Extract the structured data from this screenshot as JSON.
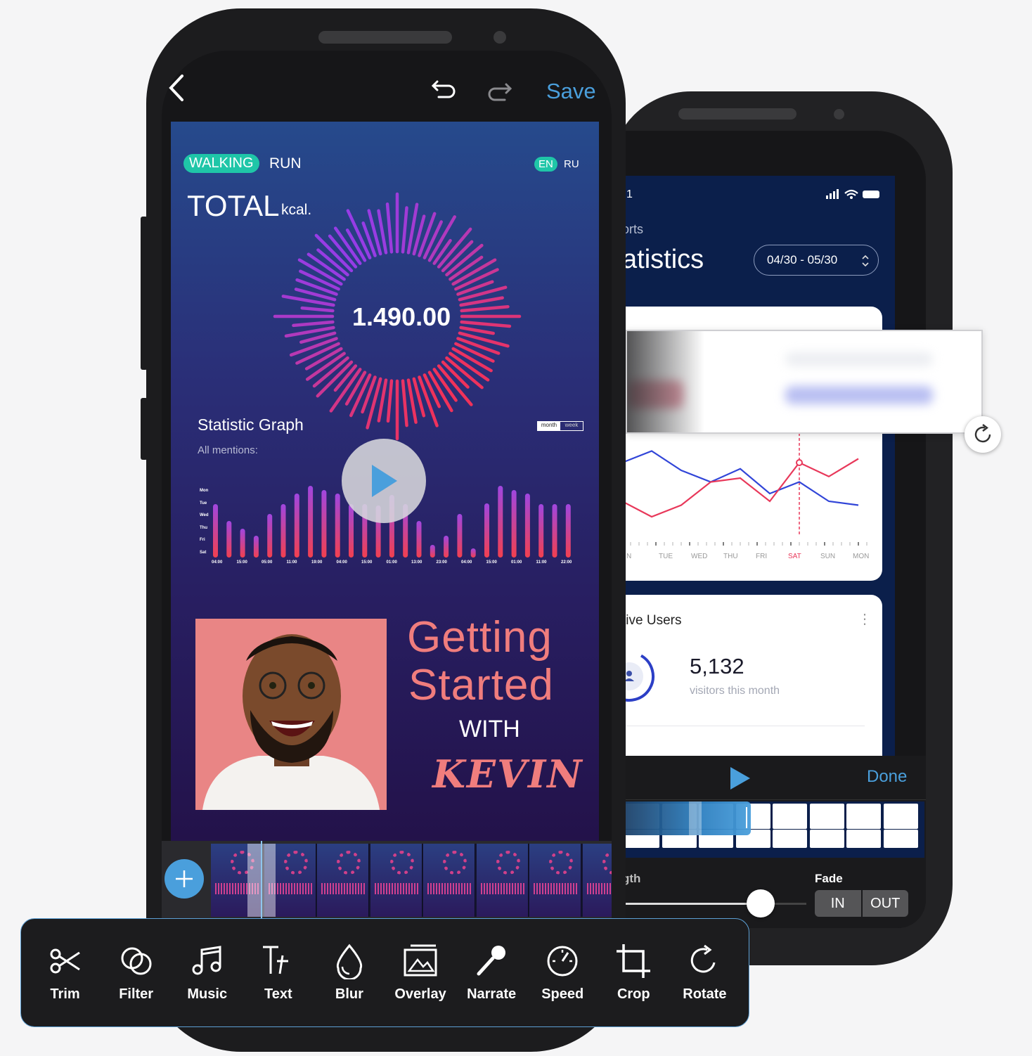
{
  "back_phone": {
    "status_time": "1",
    "breadcrumb": "orts",
    "title": "atistics",
    "date_range": "04/30 - 05/30",
    "chart_days": [
      "N",
      "TUE",
      "WED",
      "THU",
      "FRI",
      "SAT",
      "SUN",
      "MON"
    ],
    "highlight_day": "SAT",
    "series_red": [
      30,
      10,
      25,
      55,
      60,
      30,
      80,
      62,
      85
    ],
    "series_blue": [
      80,
      95,
      70,
      55,
      72,
      40,
      55,
      30,
      25
    ],
    "users_card": {
      "title": "tive Users",
      "value": "5,132",
      "caption": "visitors this month"
    },
    "editor": {
      "done_label": "Done",
      "length_label": "gth",
      "fade_label": "Fade",
      "fade_in": "IN",
      "fade_out": "OUT",
      "slider_value": 0.75
    }
  },
  "front_phone": {
    "save_label": "Save",
    "video": {
      "tab_walking": "WALKING",
      "tab_run": "RUN",
      "lang_en": "EN",
      "lang_ru": "RU",
      "total_label": "TOTAL",
      "total_unit": "kcal.",
      "total_value": "1.490.00",
      "graph_title": "Statistic Graph",
      "graph_subtitle": "All mentions:",
      "toggle_month": "month",
      "toggle_week": "week",
      "y_labels": [
        "Mon",
        "Tue",
        "Wed",
        "Thu",
        "Fri",
        "Sat"
      ],
      "x_labels": [
        "04:00",
        "15:00",
        "05:00",
        "11:00",
        "19:00",
        "04:00",
        "15:00",
        "01:00",
        "13:00",
        "23:00",
        "04:00",
        "15:00",
        "01:00",
        "11:00",
        "22:00"
      ],
      "bars": [
        76,
        52,
        41,
        31,
        62,
        76,
        91,
        102,
        96,
        91,
        76,
        76,
        74,
        89,
        76,
        52,
        18,
        31,
        62,
        13,
        77,
        102,
        96,
        91,
        76,
        76,
        76
      ],
      "headline_1": "Getting",
      "headline_2": "Started",
      "headline_3": "WITH",
      "headline_4": "KEVIN"
    }
  },
  "toolbar": {
    "items": [
      {
        "label": "Trim",
        "icon": "scissors-icon"
      },
      {
        "label": "Filter",
        "icon": "filter-icon"
      },
      {
        "label": "Music",
        "icon": "music-icon"
      },
      {
        "label": "Text",
        "icon": "text-icon"
      },
      {
        "label": "Blur",
        "icon": "blur-drop-icon"
      },
      {
        "label": "Overlay",
        "icon": "overlay-image-icon"
      },
      {
        "label": "Narrate",
        "icon": "microphone-icon"
      },
      {
        "label": "Speed",
        "icon": "speedometer-icon"
      },
      {
        "label": "Crop",
        "icon": "crop-icon"
      },
      {
        "label": "Rotate",
        "icon": "rotate-icon"
      }
    ]
  },
  "colors": {
    "accent": "#4a9fdc",
    "headline": "#f07d7d",
    "walking": "#1fc6a8",
    "back_navy": "#0b1f4b"
  }
}
